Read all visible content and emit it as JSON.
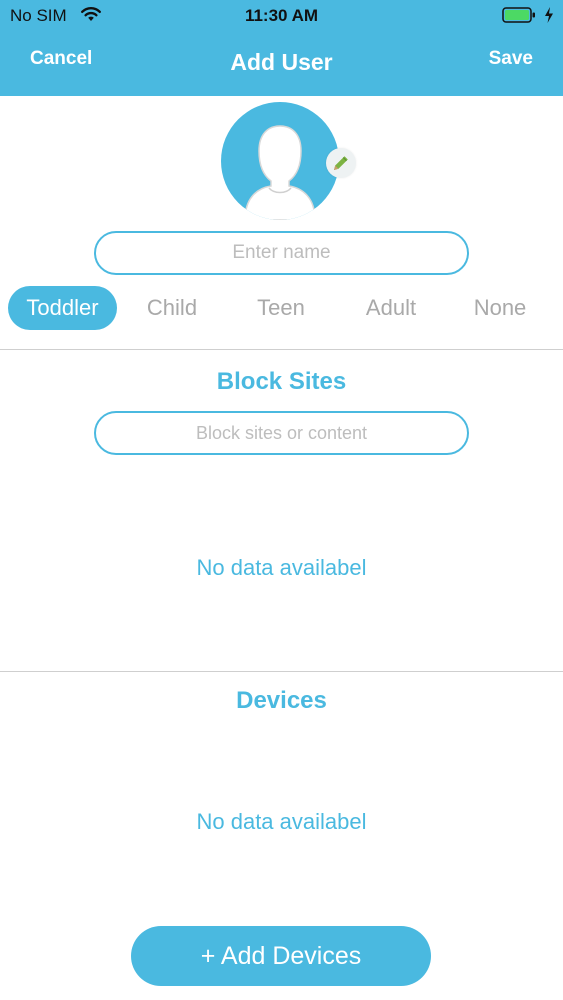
{
  "status_bar": {
    "carrier": "No SIM",
    "time": "11:30 AM",
    "wifi_icon": "wifi-icon",
    "battery_icon": "battery-charging-icon"
  },
  "nav": {
    "cancel_label": "Cancel",
    "title": "Add User",
    "save_label": "Save"
  },
  "profile": {
    "avatar_icon": "user-silhouette-icon",
    "edit_icon": "pencil-icon",
    "name_value": "",
    "name_placeholder": "Enter name"
  },
  "age_groups": {
    "selected": "Toddler",
    "options": [
      "Toddler",
      "Child",
      "Teen",
      "Adult",
      "None"
    ]
  },
  "block_sites": {
    "title": "Block Sites",
    "search_placeholder": "Block sites or content",
    "empty_text": "No data availabel"
  },
  "devices": {
    "title": "Devices",
    "empty_text": "No data availabel",
    "add_button_label": "+ Add Devices"
  },
  "colors": {
    "accent": "#4ab9e0",
    "inactive_text": "#a9a9a9",
    "divider": "#cfcfcf",
    "badge_background": "#eef2f3",
    "pencil": "#7cb342"
  }
}
